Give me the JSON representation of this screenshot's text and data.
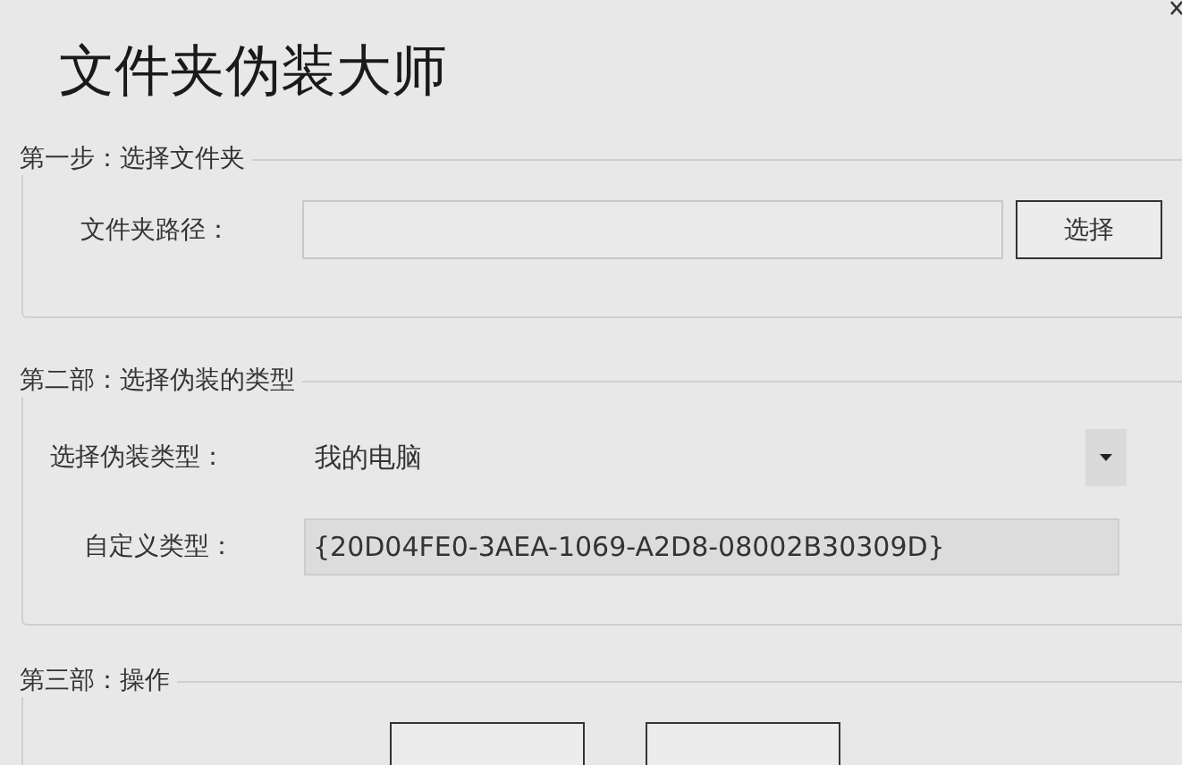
{
  "window": {
    "title": "文件夹伪装大师"
  },
  "step1": {
    "legend": "第一步：选择文件夹",
    "path_label": "文件夹路径：",
    "browse_button": "选择"
  },
  "step2": {
    "legend": "第二部：选择伪装的类型",
    "type_label": "选择伪装类型：",
    "type_value": "我的电脑",
    "custom_label": "自定义类型：",
    "custom_value": "{20D04FE0-3AEA-1069-A2D8-08002B30309D}"
  },
  "step3": {
    "legend": "第三部：操作",
    "buttons": [
      {
        "kind": "action"
      },
      {
        "kind": "action"
      }
    ]
  }
}
